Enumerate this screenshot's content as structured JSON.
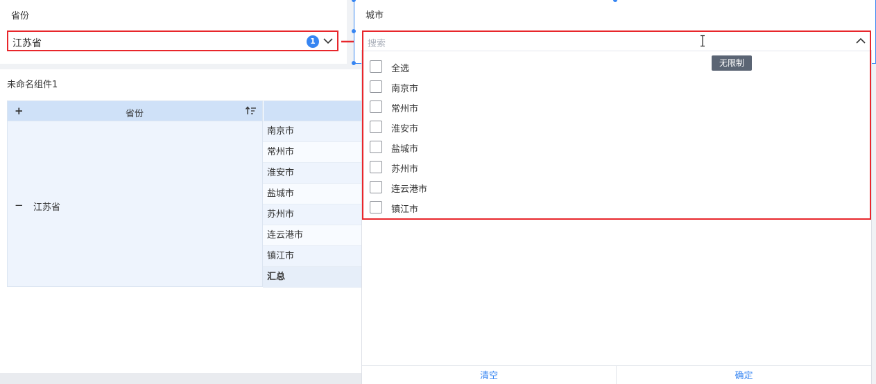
{
  "province_filter": {
    "title": "省份",
    "selected_value": "江苏省",
    "selected_count": "1"
  },
  "city_filter": {
    "title": "城市",
    "search_placeholder": "搜索",
    "tooltip": "无限制",
    "options": [
      "全选",
      "南京市",
      "常州市",
      "淮安市",
      "盐城市",
      "苏州市",
      "连云港市",
      "镇江市"
    ],
    "clear_label": "清空",
    "confirm_label": "确定"
  },
  "table_widget": {
    "title": "未命名组件1",
    "header_province": "省份",
    "province_value": "江苏省",
    "cities": [
      "南京市",
      "常州市",
      "淮安市",
      "盐城市",
      "苏州市",
      "连云港市",
      "镇江市"
    ],
    "total_label": "汇总"
  },
  "colors": {
    "accent": "#3685f2",
    "highlight_border": "#e8262b",
    "header_bg": "#cfe1f8"
  }
}
